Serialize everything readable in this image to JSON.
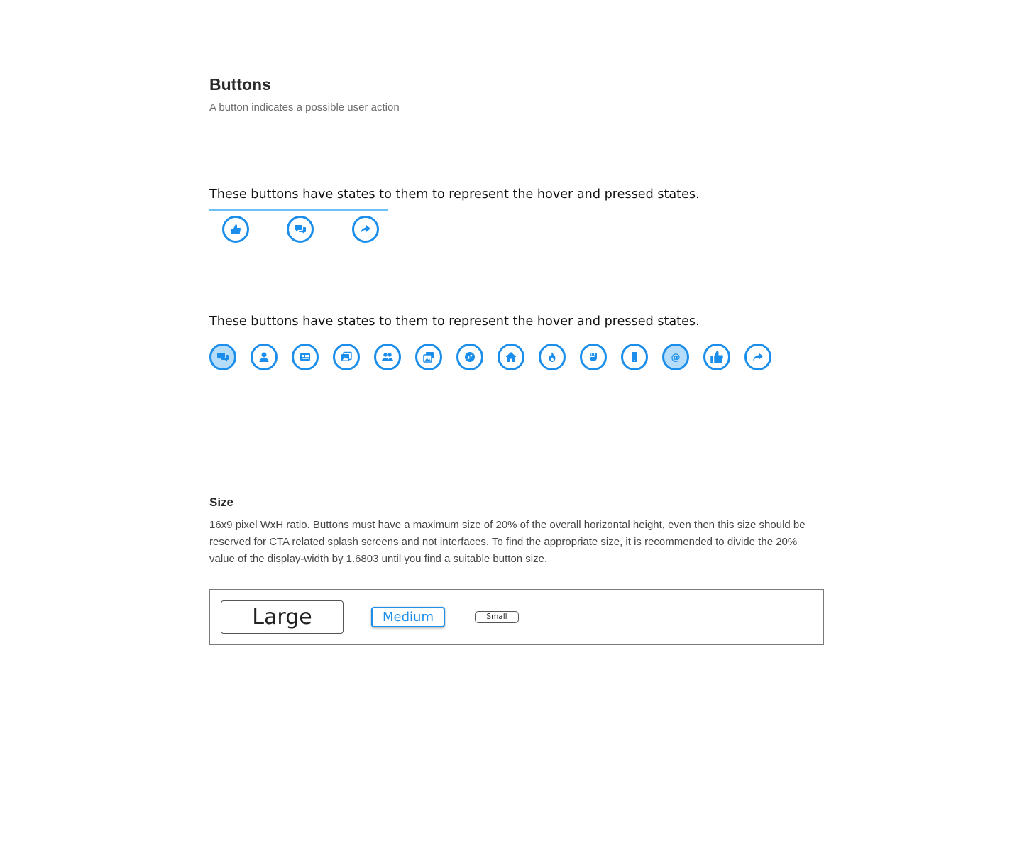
{
  "header": {
    "title": "Buttons",
    "subtitle": "A button indicates a possible user action"
  },
  "section_one": {
    "caption": "These buttons have states to them to represent the hover and pressed states.",
    "icons": [
      "thumbs-up-icon",
      "chat-bubbles-icon",
      "share-arrow-icon"
    ]
  },
  "section_two": {
    "caption": "These buttons have states to them to represent the hover and pressed states.",
    "icons": [
      "chat-bubbles-icon",
      "user-icon",
      "newspaper-icon",
      "photos-icon",
      "users-icon",
      "images-icon",
      "compass-icon",
      "home-icon",
      "fire-icon",
      "fist-icon",
      "mobile-icon",
      "at-sign-icon",
      "thumbs-up-icon",
      "share-arrow-icon"
    ],
    "pressed": [
      "chat-bubbles-icon",
      "at-sign-icon"
    ]
  },
  "size": {
    "title": "Size",
    "description": "16x9 pixel WxH ratio. Buttons must have a maximum size of 20% of the overall horizontal height, even then this size should be reserved for CTA related splash screens and not interfaces. To find the appropriate size, it is recommended to divide the 20% value of the display-width by 1.6803 until you find a suitable button size.",
    "large_label": "Large",
    "medium_label": "Medium",
    "small_label": "Small"
  },
  "colors": {
    "accent": "#1a8eea",
    "pressed_fill": "#b5dcf8",
    "underline": "#6cc0f5"
  }
}
